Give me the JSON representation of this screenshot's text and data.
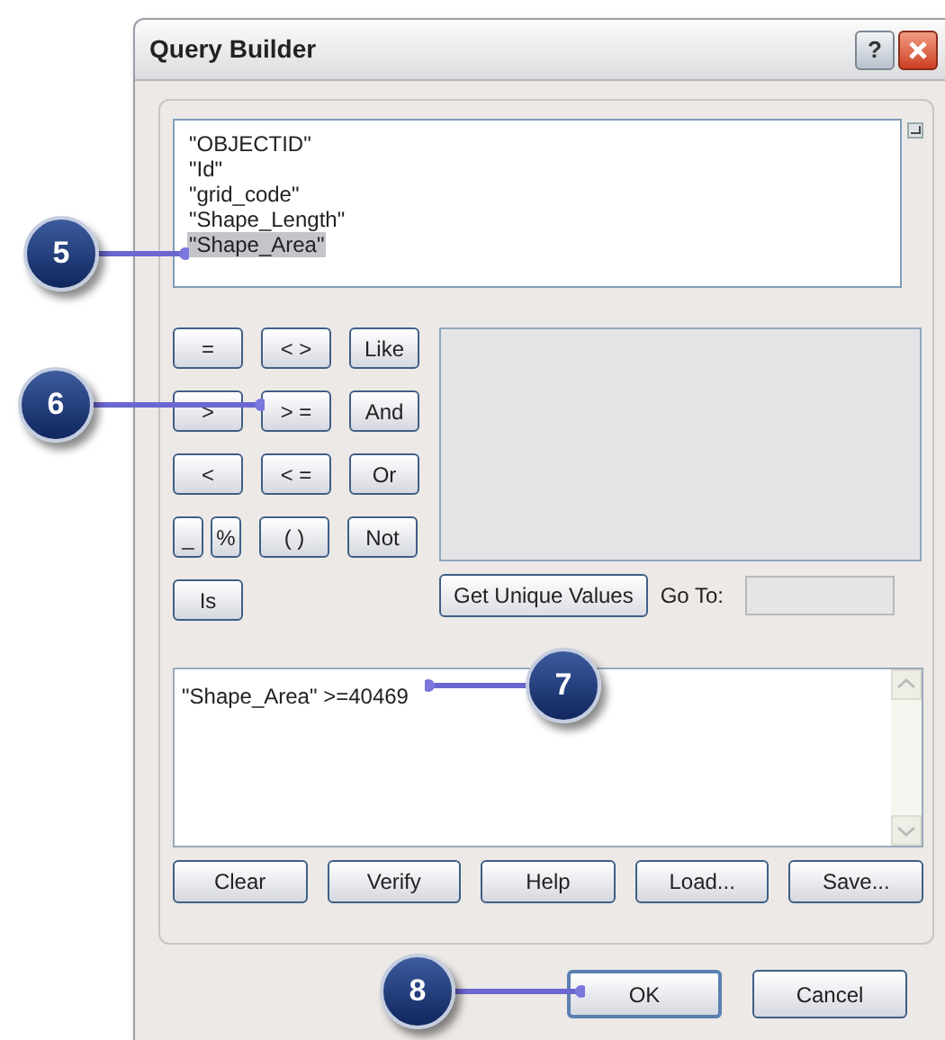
{
  "window": {
    "title": "Query Builder",
    "help_button": "?"
  },
  "fields": [
    {
      "label": "\"OBJECTID\"",
      "selected": false
    },
    {
      "label": "\"Id\"",
      "selected": false
    },
    {
      "label": "\"grid_code\"",
      "selected": false
    },
    {
      "label": "\"Shape_Length\"",
      "selected": false
    },
    {
      "label": "\"Shape_Area\"",
      "selected": true
    }
  ],
  "operators": [
    [
      {
        "label": "=",
        "kind": "wide"
      },
      {
        "label": "< >",
        "kind": "wide"
      },
      {
        "label": "Like",
        "kind": "wide"
      }
    ],
    [
      {
        "label": ">",
        "kind": "wide"
      },
      {
        "label": "> =",
        "kind": "wide"
      },
      {
        "label": "And",
        "kind": "wide"
      }
    ],
    [
      {
        "label": "<",
        "kind": "wide"
      },
      {
        "label": "< =",
        "kind": "wide"
      },
      {
        "label": "Or",
        "kind": "wide"
      }
    ],
    [
      {
        "label": "_",
        "kind": "narrow"
      },
      {
        "label": "%",
        "kind": "narrow"
      },
      {
        "label": "( )",
        "kind": "wide"
      },
      {
        "label": "Not",
        "kind": "wide"
      }
    ],
    [
      {
        "label": "Is",
        "kind": "wide"
      }
    ]
  ],
  "unique_values_button": "Get Unique Values",
  "goto_label": "Go To:",
  "expression": "\"Shape_Area\" >=40469",
  "expression_buttons": [
    "Clear",
    "Verify",
    "Help",
    "Load...",
    "Save..."
  ],
  "dialog_buttons": [
    {
      "label": "OK",
      "default": true
    },
    {
      "label": "Cancel",
      "default": false
    }
  ],
  "callouts": [
    "5",
    "6",
    "7",
    "8"
  ]
}
